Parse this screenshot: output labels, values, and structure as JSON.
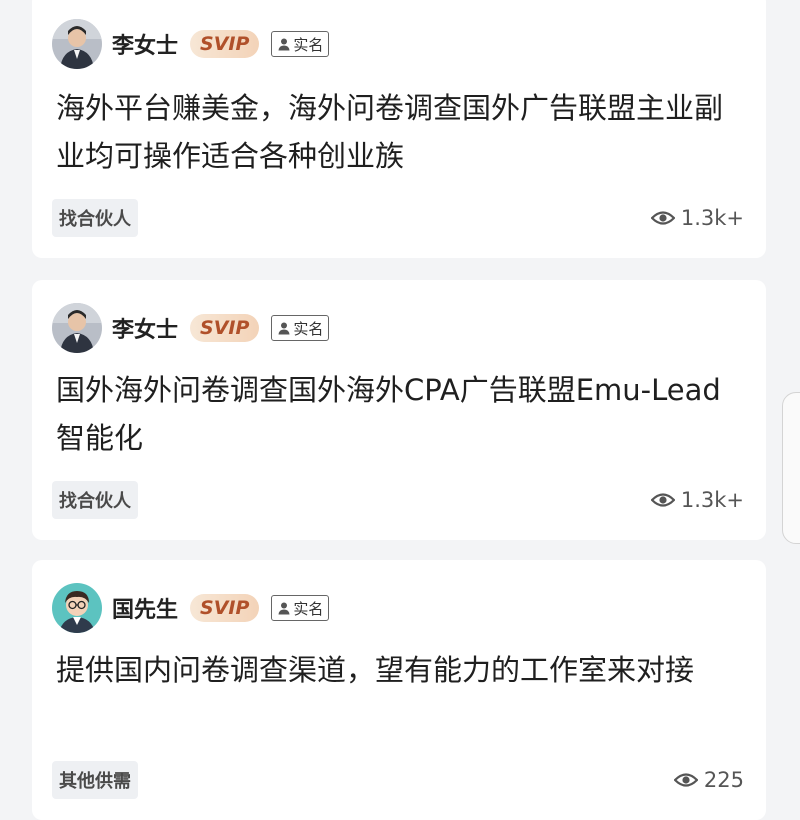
{
  "posts": [
    {
      "author": "李女士",
      "vip": "SVIP",
      "verified": "实名",
      "title": "海外平台赚美金，海外问卷调查国外广告联盟主业副业均可操作适合各种创业族",
      "tag": "找合伙人",
      "views": "1.3k+",
      "avatar": "businesswoman-portrait"
    },
    {
      "author": "李女士",
      "vip": "SVIP",
      "verified": "实名",
      "title": "国外海外问卷调查国外海外CPA广告联盟Emu-Lead智能化",
      "tag": "找合伙人",
      "views": "1.3k+",
      "avatar": "businesswoman-portrait"
    },
    {
      "author": "国先生",
      "vip": "SVIP",
      "verified": "实名",
      "title": "提供国内问卷调查渠道，望有能力的工作室来对接",
      "tag": "其他供需",
      "views": "225",
      "avatar": "cartoon-man-glasses"
    }
  ],
  "colors": {
    "background": "#f3f4f6",
    "card": "#ffffff",
    "vip_text": "#b0502a",
    "vip_bg_start": "#f7e7d6",
    "vip_bg_end": "#f3d3b8",
    "tag_bg": "#eef0f3"
  },
  "icons": {
    "verified": "person-icon",
    "views": "eye-icon"
  }
}
